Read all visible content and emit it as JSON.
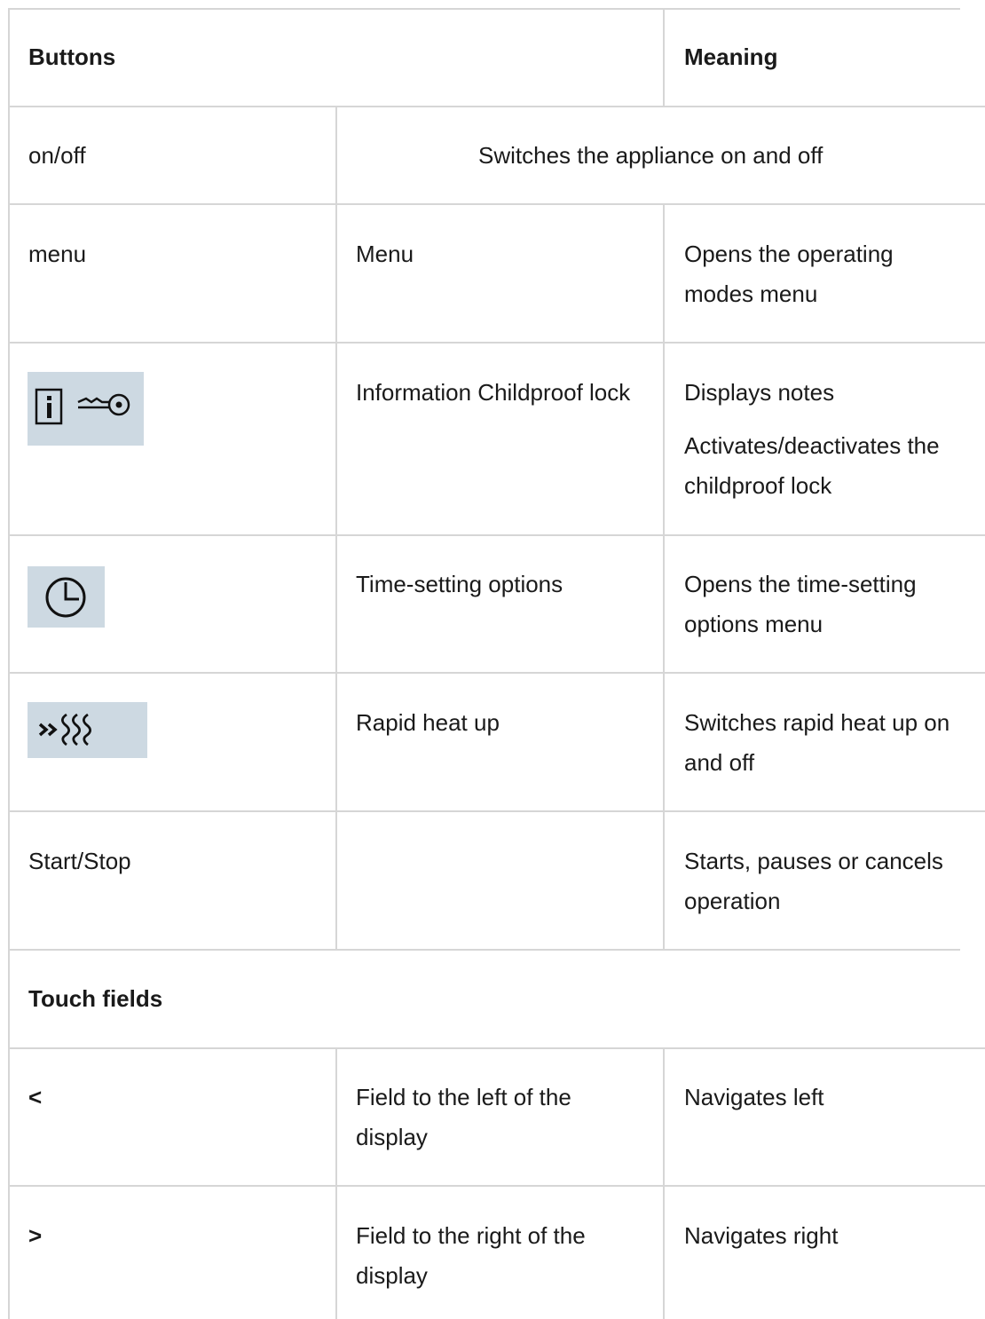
{
  "table": {
    "header": {
      "buttons": "Buttons",
      "meaning": "Meaning"
    },
    "rows": [
      {
        "button": "on/off",
        "label": "",
        "meaning": "Switches the appliance on and off"
      },
      {
        "button": "menu",
        "label": "Menu",
        "meaning": "Opens the operating modes menu"
      },
      {
        "button_icon": "info-childproof-lock-icon",
        "label": "Information Childproof lock",
        "meaning": "Displays notes",
        "meaning_2": "Activates/deactivates the childproof lock"
      },
      {
        "button_icon": "clock-icon",
        "label": "Time-setting options",
        "meaning": "Opens the time-setting options menu"
      },
      {
        "button_icon": "rapid-heat-up-icon",
        "label": "Rapid heat up",
        "meaning": "Switches rapid heat up on and off"
      },
      {
        "button": "Start/Stop",
        "label": "",
        "meaning": "Starts, pauses or cancels operation"
      }
    ],
    "section": {
      "title": "Touch fields"
    },
    "touch_rows": [
      {
        "button": "<",
        "label": "Field to the left of the display",
        "meaning": "Navigates left"
      },
      {
        "button": ">",
        "label": "Field to the right of the display",
        "meaning": "Navigates right"
      }
    ]
  },
  "colors": {
    "grid": "#d6d6d6",
    "icon_background": "#cdd9e2",
    "text": "#1a1a1a"
  }
}
